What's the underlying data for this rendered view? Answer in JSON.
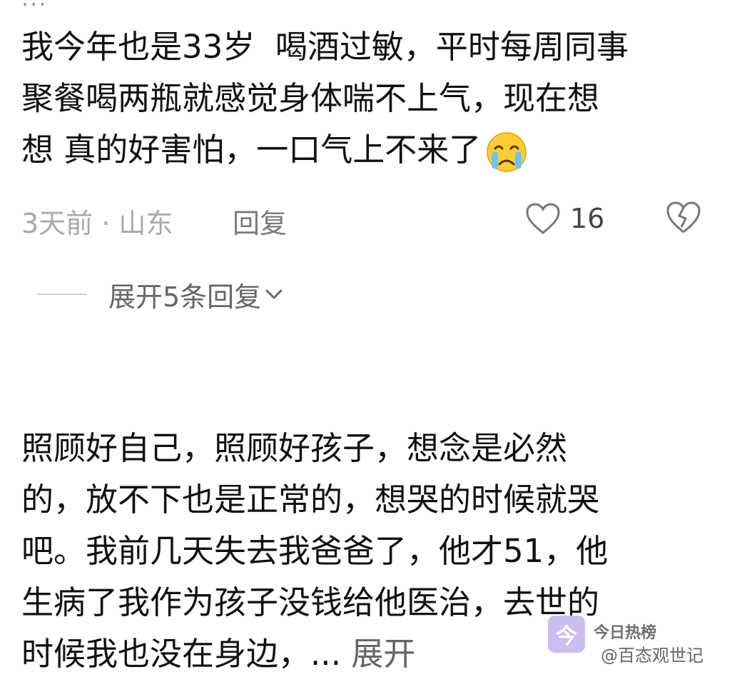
{
  "top": {
    "cropped_name": "..."
  },
  "comments": [
    {
      "lines": [
        "我今年也是33岁  喝酒过敏，平时每周同事",
        "聚餐喝两瓶就感觉身体喘不上气，现在想",
        "想 真的好害怕，一口气上不来了"
      ],
      "emoji": "crying-face-icon",
      "meta": {
        "time_location": "3天前 · 山东",
        "reply_label": "回复",
        "likes": "16"
      },
      "expand_replies": "展开5条回复"
    },
    {
      "lines": [
        "照顾好自己，照顾好孩子，想念是必然",
        "的，放不下也是正常的，想哭的时候就哭",
        "吧。我前几天失去我爸爸了，他才51，他",
        "生病了我作为孩子没钱给他医治，去世的",
        "时候我也没在身边，..."
      ],
      "expand_label": "展开"
    }
  ],
  "watermark": {
    "logo_glyph": "今",
    "title": "今日热榜",
    "subtitle": "@百态观世记"
  },
  "colors": {
    "text": "#111111",
    "muted": "#a9a9a9",
    "reply": "#7a7a7a"
  }
}
